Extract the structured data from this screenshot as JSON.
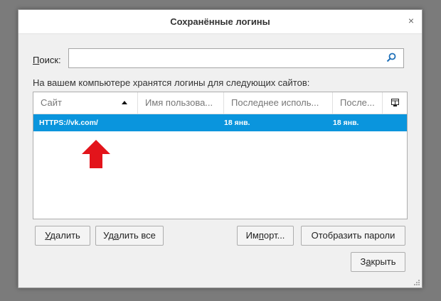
{
  "dialog": {
    "title": "Сохранённые логины",
    "close_glyph": "×"
  },
  "search": {
    "label_accel": "П",
    "label_rest": "оиск:",
    "value": "",
    "placeholder": ""
  },
  "info_text": "На вашем компьютере хранятся логины для следующих сайтов:",
  "table": {
    "columns": [
      "Сайт",
      "Имя пользова...",
      "Последнее исполь...",
      "После..."
    ],
    "rows": [
      {
        "site": "HTTPS://vk.com/",
        "user": "",
        "last_used": "18 янв.",
        "last_changed": "18 янв."
      }
    ]
  },
  "buttons": {
    "delete_accel": "У",
    "delete_rest": "далить",
    "delete_all_pre": "Уд",
    "delete_all_accel": "а",
    "delete_all_rest": "лить все",
    "import_pre": "Им",
    "import_accel": "п",
    "import_rest": "орт...",
    "show_passwords": "Отобразить пароли",
    "close_pre": "З",
    "close_accel": "а",
    "close_rest": "крыть"
  },
  "colors": {
    "selection": "#0a95dd",
    "annotation_arrow": "#e3141b"
  }
}
